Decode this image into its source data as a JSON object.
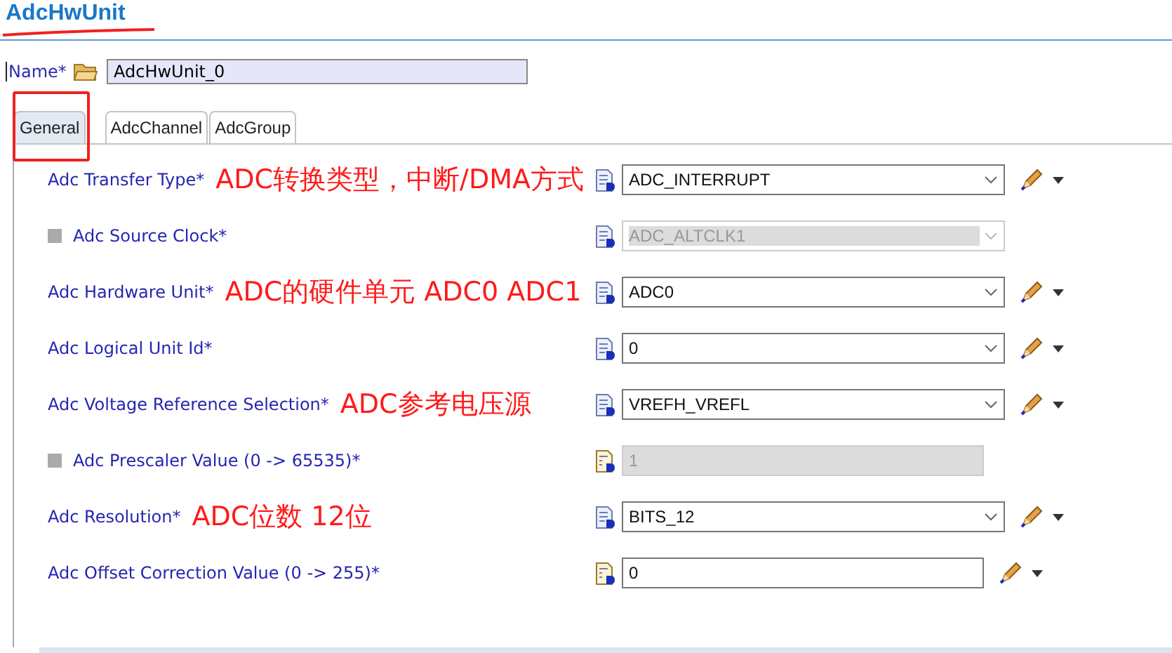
{
  "header": {
    "title": "AdcHwUnit"
  },
  "name_field": {
    "label": "Name*",
    "value": "AdcHwUnit_0"
  },
  "tabs": [
    {
      "label": "General",
      "selected": true
    },
    {
      "label": "AdcChannel",
      "selected": false
    },
    {
      "label": "AdcGroup",
      "selected": false
    }
  ],
  "parameters": [
    {
      "label": "Adc Transfer Type*",
      "optional": false,
      "annotation": "ADC转换类型，中断/DMA方式",
      "kind": "combo",
      "value": "ADC_INTERRUPT",
      "disabled": false
    },
    {
      "label": "Adc Source Clock*",
      "optional": true,
      "kind": "combo",
      "value": "ADC_ALTCLK1",
      "disabled": true
    },
    {
      "label": "Adc Hardware Unit*",
      "optional": false,
      "annotation": "ADC的硬件单元 ADC0 ADC1",
      "kind": "combo",
      "value": "ADC0",
      "disabled": false
    },
    {
      "label": "Adc Logical Unit Id*",
      "optional": false,
      "kind": "combo",
      "value": "0",
      "disabled": false
    },
    {
      "label": "Adc Voltage Reference Selection*",
      "optional": false,
      "annotation": "ADC参考电压源",
      "kind": "combo",
      "value": "VREFH_VREFL",
      "disabled": false
    },
    {
      "label": "Adc Prescaler Value (0 -> 65535)*",
      "optional": true,
      "kind": "text",
      "value": "1",
      "disabled": true
    },
    {
      "label": "Adc Resolution*",
      "optional": false,
      "annotation": "ADC位数 12位",
      "kind": "combo",
      "value": "BITS_12",
      "disabled": false
    },
    {
      "label": "Adc Offset Correction Value (0 -> 255)*",
      "optional": false,
      "kind": "text",
      "value": "0",
      "disabled": false
    }
  ]
}
